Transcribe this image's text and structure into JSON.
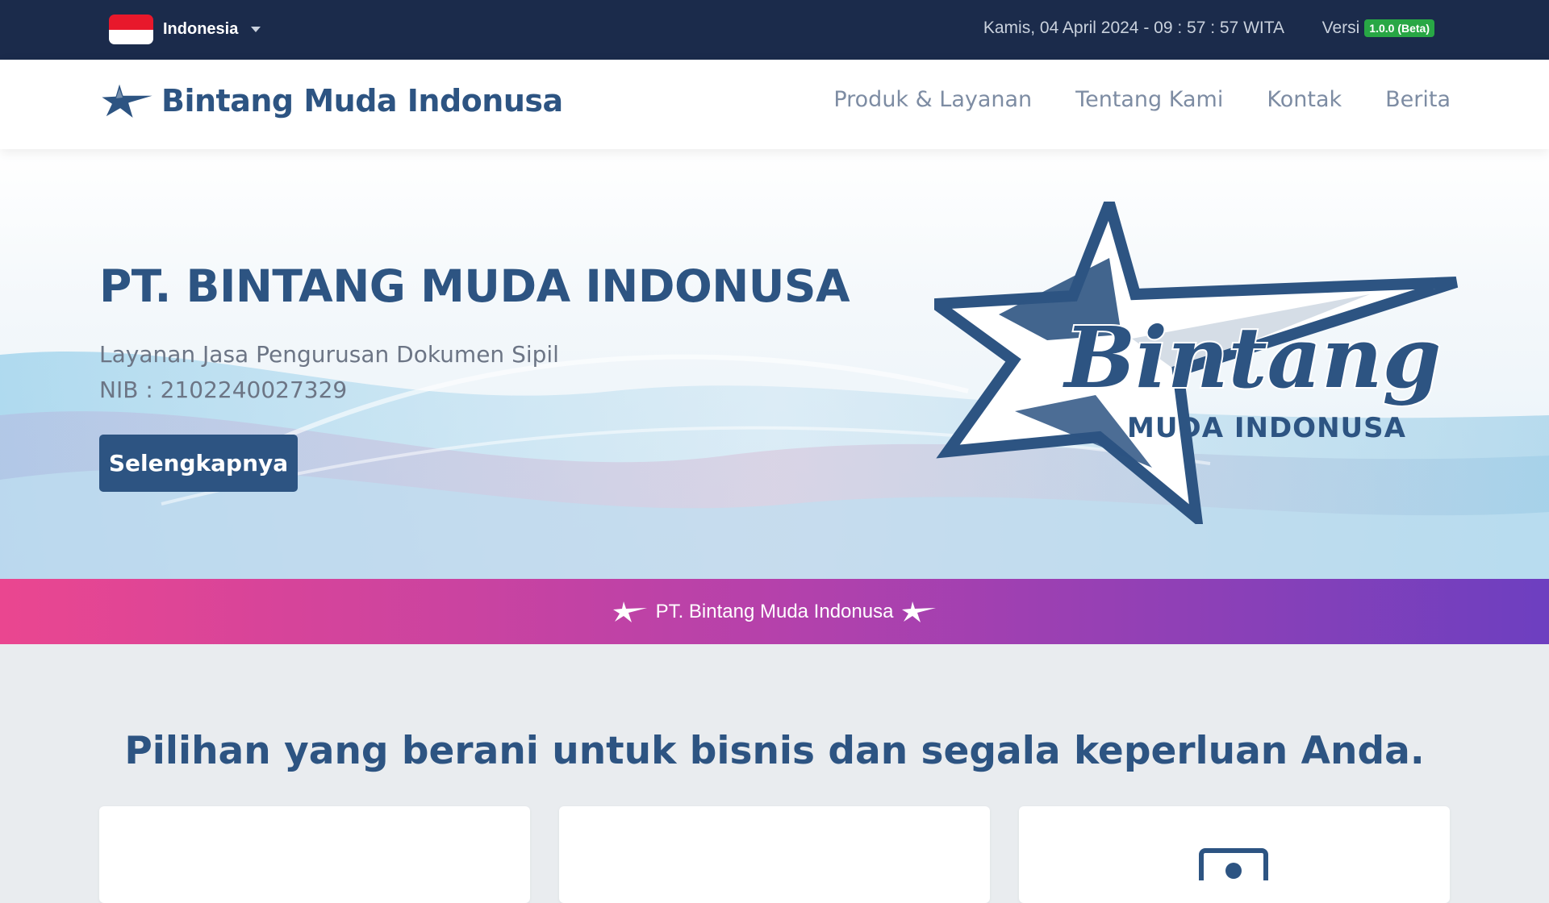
{
  "topbar": {
    "language": "Indonesia",
    "datetime": "Kamis, 04 April 2024 - 09 : 57 : 57 WITA",
    "version_label": "Versi",
    "version_badge": "1.0.0 (Beta)"
  },
  "navbar": {
    "brand": "Bintang Muda Indonusa",
    "links": [
      "Produk & Layanan",
      "Tentang Kami",
      "Kontak",
      "Berita"
    ]
  },
  "hero": {
    "title": "PT. BINTANG MUDA INDONUSA",
    "subtitle": "Layanan Jasa Pengurusan Dokumen Sipil",
    "nib": "NIB : 2102240027329",
    "button": "Selengkapnya",
    "logo_script": "Bintang",
    "logo_sub": "MUDA INDONUSA"
  },
  "ribbon": {
    "text": "PT. Bintang Muda Indonusa"
  },
  "section": {
    "title": "Pilihan yang berani untuk bisnis dan segala keperluan Anda."
  },
  "colors": {
    "topbar_bg": "#1b2b4b",
    "brand_blue": "#2d5482",
    "nav_text": "#7d8ca3",
    "badge_green": "#28a745",
    "ribbon_start": "#ea4690",
    "ribbon_end": "#6d3fc0"
  },
  "icons": {
    "flag": "indonesia-flag-icon",
    "brand": "star-icon",
    "ribbon": "sparkle-star-icon",
    "card3": "money-icon"
  }
}
